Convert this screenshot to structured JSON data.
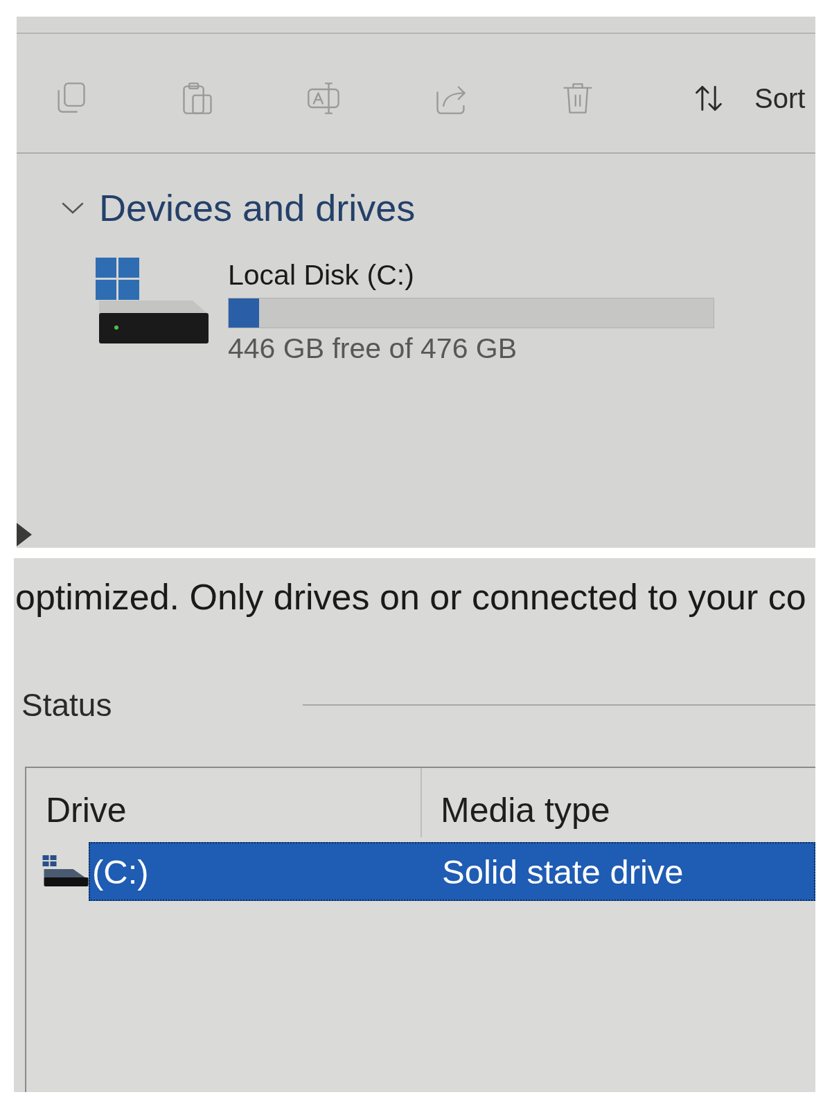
{
  "toolbar": {
    "buttons": [
      {
        "kind": "copy",
        "disabled": true
      },
      {
        "kind": "paste",
        "disabled": true
      },
      {
        "kind": "rename",
        "disabled": true
      },
      {
        "kind": "share",
        "disabled": true
      },
      {
        "kind": "delete",
        "disabled": true
      }
    ],
    "sort": {
      "label": "Sort",
      "disabled": false
    }
  },
  "devices": {
    "title": "Devices and drives",
    "expanded": true,
    "drives": [
      {
        "name": "Local Disk (C:)",
        "level": 0.063,
        "free_text": "446 GB free of 476 GB"
      }
    ]
  },
  "optimize": {
    "description": "optimized. Only drives on or connected to your co",
    "status_label": "Status",
    "table": {
      "columns": [
        "Drive",
        "Media type"
      ],
      "rows": [
        {
          "drive": "(C:)",
          "media_type": "Solid state drive",
          "selected": true
        }
      ]
    }
  }
}
